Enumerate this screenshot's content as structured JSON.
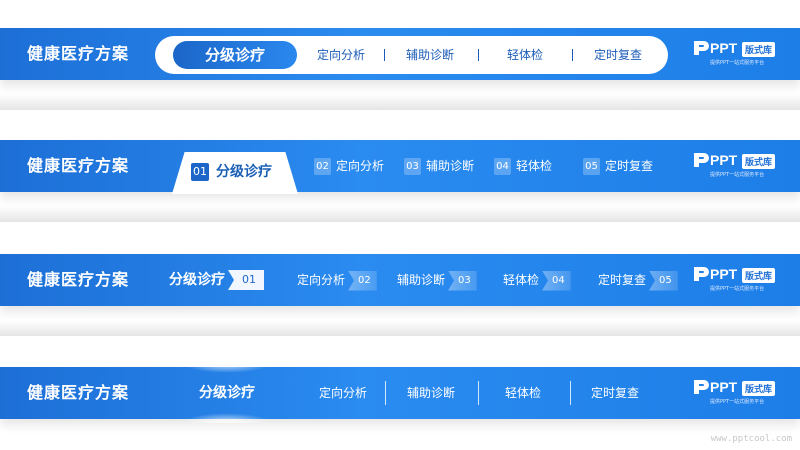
{
  "app_title": "健康医疗方案",
  "logo": {
    "mark": "PPT",
    "badge": "版式库",
    "tagline": "提供PPT一站式服务平台"
  },
  "bar1": {
    "active": "分级诊疗",
    "items": [
      "定向分析",
      "辅助诊断",
      "轻体检",
      "定时复查"
    ]
  },
  "bar2": {
    "active": {
      "num": "01",
      "label": "分级诊疗"
    },
    "items": [
      {
        "num": "02",
        "label": "定向分析"
      },
      {
        "num": "03",
        "label": "辅助诊断"
      },
      {
        "num": "04",
        "label": "轻体检"
      },
      {
        "num": "05",
        "label": "定时复查"
      }
    ]
  },
  "bar3": {
    "active": {
      "num": "01",
      "label": "分级诊疗"
    },
    "items": [
      {
        "num": "02",
        "label": "定向分析"
      },
      {
        "num": "03",
        "label": "辅助诊断"
      },
      {
        "num": "04",
        "label": "轻体检"
      },
      {
        "num": "05",
        "label": "定时复查"
      }
    ]
  },
  "bar4": {
    "active": "分级诊疗",
    "items": [
      "定向分析",
      "辅助诊断",
      "轻体检",
      "定时复查"
    ]
  },
  "watermark": "www.pptcool.com",
  "colors": {
    "primary": "#1d6fd6",
    "accent": "#2a8bf0",
    "text_dark": "#1d5db8"
  }
}
